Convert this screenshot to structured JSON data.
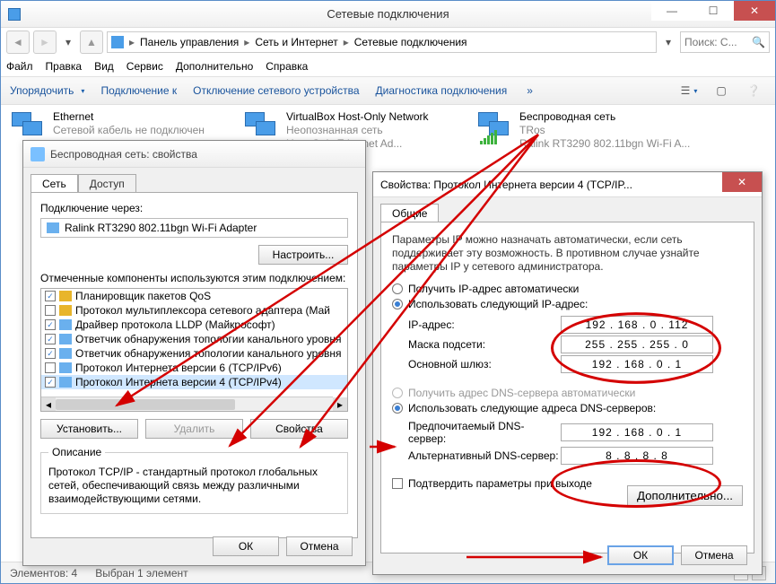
{
  "window": {
    "title": "Сетевые подключения",
    "breadcrumb": [
      "Панель управления",
      "Сеть и Интернет",
      "Сетевые подключения"
    ],
    "search_placeholder": "Поиск: С..."
  },
  "menu": {
    "file": "Файл",
    "edit": "Правка",
    "view": "Вид",
    "service": "Сервис",
    "extra": "Дополнительно",
    "help": "Справка"
  },
  "toolbar": {
    "organize": "Упорядочить",
    "connect": "Подключение к",
    "disable": "Отключение сетевого устройства",
    "diag": "Диагностика подключения"
  },
  "connections": [
    {
      "name": "Ethernet",
      "line2": "Сетевой кабель не подключен",
      "line3": ""
    },
    {
      "name": "VirtualBox Host-Only Network",
      "line2": "Неопознанная сеть",
      "line3": "Host-Only Ethernet Ad..."
    },
    {
      "name": "Беспроводная сеть",
      "line2": "TRos",
      "line3": "Ralink RT3290 802.11bgn Wi-Fi A..."
    }
  ],
  "status": {
    "elements": "Элементов: 4",
    "selected": "Выбран 1 элемент"
  },
  "dlg1": {
    "title": "Беспроводная сеть: свойства",
    "tab_net": "Сеть",
    "tab_access": "Доступ",
    "conn_via": "Подключение через:",
    "adapter": "Ralink RT3290 802.11bgn Wi-Fi Adapter",
    "configure": "Настроить...",
    "components_label": "Отмеченные компоненты используются этим подключением:",
    "items": [
      {
        "checked": true,
        "label": "Планировщик пакетов QoS"
      },
      {
        "checked": false,
        "label": "Протокол мультиплексора сетевого адаптера (Май"
      },
      {
        "checked": true,
        "label": "Драйвер протокола LLDP (Майкрософт)"
      },
      {
        "checked": true,
        "label": "Ответчик обнаружения топологии канального уровня"
      },
      {
        "checked": true,
        "label": "Ответчик обнаружения топологии канального уровня"
      },
      {
        "checked": false,
        "label": "Протокол Интернета версии 6 (TCP/IPv6)"
      },
      {
        "checked": true,
        "label": "Протокол Интернета версии 4 (TCP/IPv4)",
        "selected": true
      }
    ],
    "install": "Установить...",
    "remove": "Удалить",
    "properties": "Свойства",
    "desc_title": "Описание",
    "desc_text": "Протокол TCP/IP - стандартный протокол глобальных сетей, обеспечивающий связь между различными взаимодействующими сетями.",
    "ok": "ОК",
    "cancel": "Отмена"
  },
  "dlg2": {
    "title": "Свойства: Протокол Интернета версии 4 (TCP/IP...",
    "tab_general": "Общие",
    "note": "Параметры IP можно назначать автоматически, если сеть поддерживает эту возможность. В противном случае узнайте параметры IP у сетевого администратора.",
    "r_auto_ip": "Получить IP-адрес автоматически",
    "r_manual_ip": "Использовать следующий IP-адрес:",
    "ip_label": "IP-адрес:",
    "mask_label": "Маска подсети:",
    "gw_label": "Основной шлюз:",
    "ip": "192 . 168 .  0  . 112",
    "mask": "255 . 255 . 255 .  0",
    "gw": "192 . 168 .  0  .  1",
    "r_auto_dns": "Получить адрес DNS-сервера автоматически",
    "r_manual_dns": "Использовать следующие адреса DNS-серверов:",
    "dns1_label": "Предпочитаемый DNS-сервер:",
    "dns2_label": "Альтернативный DNS-сервер:",
    "dns1": "192 . 168 .  0  .  1",
    "dns2": " 8  .  8  .  8  .  8",
    "confirm": "Подтвердить параметры при выходе",
    "advanced": "Дополнительно...",
    "ok": "ОК",
    "cancel": "Отмена"
  }
}
